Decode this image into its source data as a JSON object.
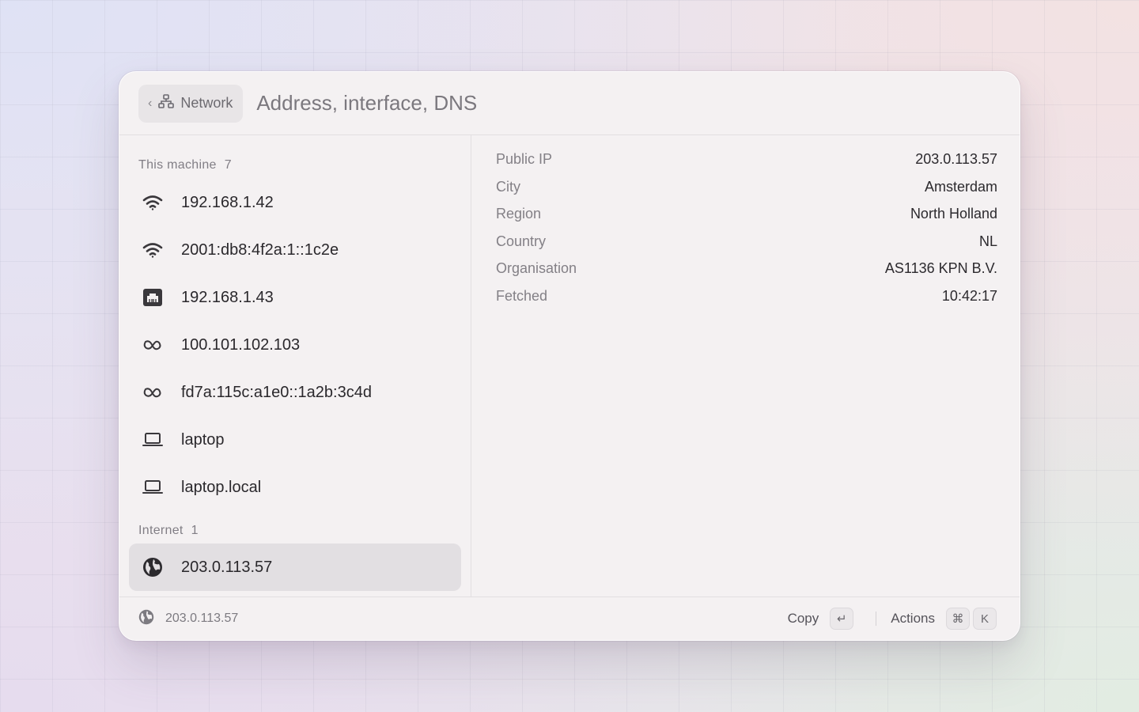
{
  "header": {
    "back_label": "Network",
    "title": "Address, interface, DNS"
  },
  "sidebar": {
    "sections": [
      {
        "title": "This machine",
        "count": "7",
        "items": [
          {
            "icon": "wifi-icon",
            "label": "192.168.1.42"
          },
          {
            "icon": "wifi-icon",
            "label": "2001:db8:4f2a:1::1c2e"
          },
          {
            "icon": "ethernet-icon",
            "label": "192.168.1.43"
          },
          {
            "icon": "tailscale-icon",
            "label": "100.101.102.103"
          },
          {
            "icon": "tailscale-icon",
            "label": "fd7a:115c:a1e0::1a2b:3c4d"
          },
          {
            "icon": "laptop-icon",
            "label": "laptop"
          },
          {
            "icon": "laptop-icon",
            "label": "laptop.local"
          }
        ]
      },
      {
        "title": "Internet",
        "count": "1",
        "items": [
          {
            "icon": "globe-icon",
            "label": "203.0.113.57",
            "selected": true
          }
        ]
      }
    ]
  },
  "detail": {
    "rows": [
      {
        "key": "Public IP",
        "value": "203.0.113.57"
      },
      {
        "key": "City",
        "value": "Amsterdam"
      },
      {
        "key": "Region",
        "value": "North Holland"
      },
      {
        "key": "Country",
        "value": "NL"
      },
      {
        "key": "Organisation",
        "value": "AS1136 KPN B.V."
      },
      {
        "key": "Fetched",
        "value": "10:42:17"
      }
    ]
  },
  "footer": {
    "selected_ip": "203.0.113.57",
    "copy_label": "Copy",
    "copy_key": "↵",
    "actions_label": "Actions",
    "actions_keys": [
      "⌘",
      "K"
    ]
  },
  "colors": {
    "window_bg": "#f4f1f2",
    "selected_bg": "#e2dfe2",
    "text_primary": "#2a282c",
    "text_secondary": "#817e85"
  }
}
